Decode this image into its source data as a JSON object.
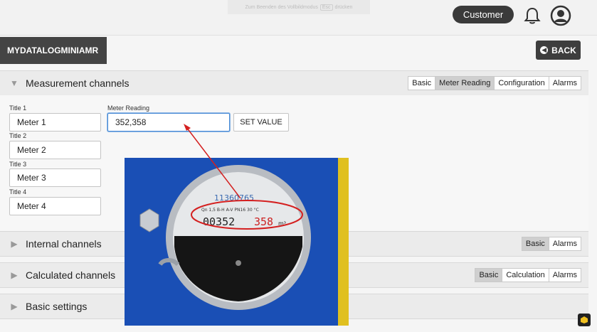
{
  "fullscreen_hint": {
    "prefix": "Zum Beenden des Vollbildmodus",
    "key": "Esc",
    "suffix": "drücken"
  },
  "header": {
    "customer_label": "Customer"
  },
  "device": {
    "name": "MYDATALOGMINIAMR",
    "back_label": "BACK"
  },
  "sections": {
    "measurement": {
      "title": "Measurement channels",
      "tabs": [
        "Basic",
        "Meter Reading",
        "Configuration",
        "Alarms"
      ],
      "active_tab": "Meter Reading"
    },
    "internal": {
      "title": "Internal channels",
      "tabs": [
        "Basic",
        "Alarms"
      ],
      "active_tab": "Basic"
    },
    "calculated": {
      "title": "Calculated channels",
      "tabs": [
        "Basic",
        "Calculation",
        "Alarms"
      ],
      "active_tab": "Basic"
    },
    "basic_settings": {
      "title": "Basic settings"
    }
  },
  "fields": {
    "title1_label": "Title 1",
    "title1_value": "Meter 1",
    "title2_label": "Title 2",
    "title2_value": "Meter 2",
    "title3_label": "Title 3",
    "title3_value": "Meter 3",
    "title4_label": "Title 4",
    "title4_value": "Meter 4",
    "meter_reading_label": "Meter Reading",
    "meter_reading_value": "352,358",
    "set_value_label": "SET VALUE"
  },
  "meter_photo": {
    "serial": "11360765",
    "spec": "Qn 1,5  B-H A-V  PN16  30 °C",
    "black_digits": "00352",
    "red_digits": "358",
    "unit": "m³"
  },
  "colors": {
    "accent_red": "#d42020",
    "meter_housing": "#1a4fb5",
    "dark_button": "#3e3e3e"
  }
}
